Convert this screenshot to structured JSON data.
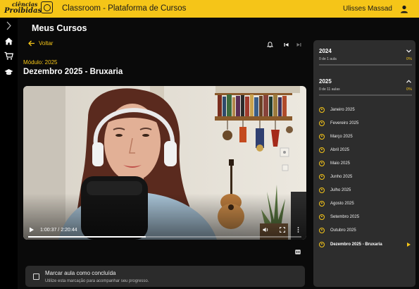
{
  "app": {
    "logo_line1": "ciências",
    "logo_line2": "Proibidas",
    "title": "Classroom - Plataforma de Cursos",
    "user_name": "Ulisses Massad"
  },
  "nav": {
    "icons": [
      "chevron-right-icon",
      "home-icon",
      "cart-icon",
      "graduation-cap-icon"
    ]
  },
  "page": {
    "title": "Meus Cursos",
    "back_label": "Voltar",
    "module_label": "Módulo: 2025",
    "lesson_title": "Dezembro 2025 - Bruxaria"
  },
  "player": {
    "time_display": "1:00:37 / 2:20:44",
    "progress_fraction": 0.43
  },
  "completion": {
    "label": "Marcar aula como concluída",
    "hint": "Utilize esta marcação para acompanhar seu progresso."
  },
  "course_panel": {
    "years": [
      {
        "year": "2024",
        "progress_text": "0 de 1 aula",
        "percent": "0%",
        "expanded": false
      },
      {
        "year": "2025",
        "progress_text": "0 de 11 aulas",
        "percent": "0%",
        "expanded": true
      }
    ],
    "lessons": [
      {
        "label": "Janeiro 2025"
      },
      {
        "label": "Fevereiro 2025"
      },
      {
        "label": "Março 2025"
      },
      {
        "label": "Abril 2025"
      },
      {
        "label": "Maio 2025"
      },
      {
        "label": "Junho 2025"
      },
      {
        "label": "Julho 2025"
      },
      {
        "label": "Agosto 2025"
      },
      {
        "label": "Setembro 2025"
      },
      {
        "label": "Outubro 2025"
      },
      {
        "label": "Dezembro 2025 - Bruxaria",
        "active": true
      }
    ]
  },
  "colors": {
    "accent": "#f5c518",
    "background": "#0a0a0a",
    "panel": "#2d2d2d"
  }
}
